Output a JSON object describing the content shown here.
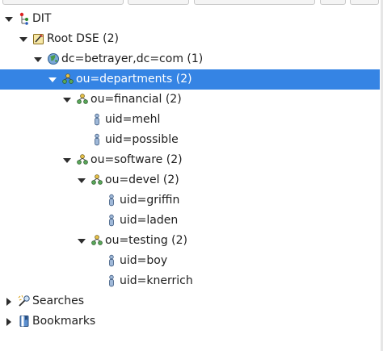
{
  "tree": {
    "root_label": "DIT",
    "root_dse": "Root DSE (2)",
    "dc_label": "dc=betrayer,dc=com (1)",
    "departments": "ou=departments (2)",
    "financial": "ou=financial (2)",
    "uid_mehl": "uid=mehl",
    "uid_possible": "uid=possible",
    "software": "ou=software (2)",
    "devel": "ou=devel (2)",
    "uid_griffin": "uid=griffin",
    "uid_laden": "uid=laden",
    "testing": "ou=testing (2)",
    "uid_boy": "uid=boy",
    "uid_knerrich": "uid=knerrich",
    "searches": "Searches",
    "bookmarks": "Bookmarks"
  },
  "colors": {
    "selection": "#3584e4",
    "ou_icon": "#3a8a3a",
    "person_icon": "#6f8fb8"
  },
  "icons": [
    "dit-icon",
    "root-dse-icon",
    "globe-icon",
    "org-unit-icon",
    "person-icon",
    "searches-icon",
    "bookmarks-icon"
  ]
}
